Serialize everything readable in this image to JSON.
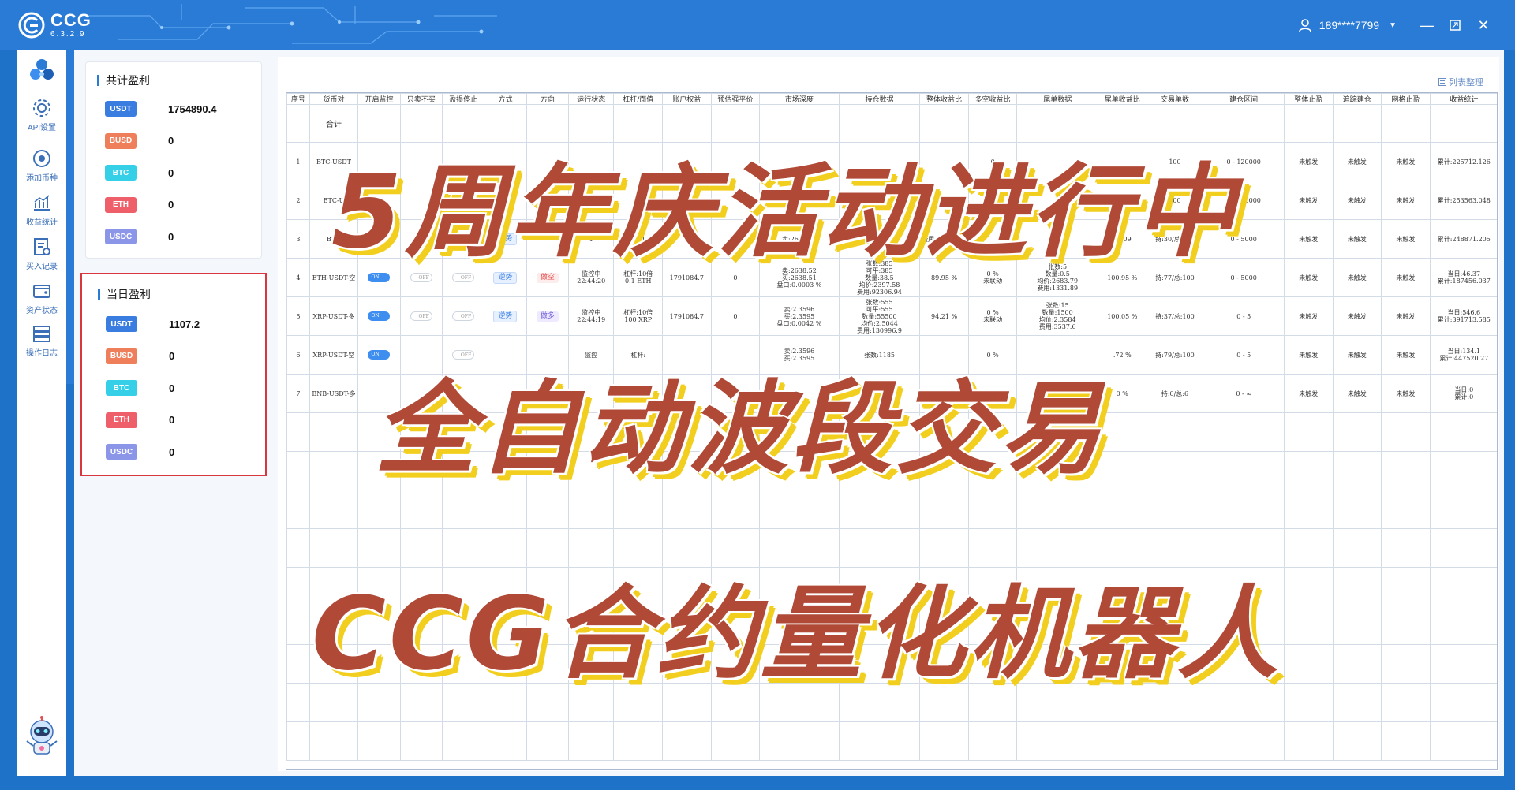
{
  "app": {
    "name": "CCG",
    "version": "6.3.2.9"
  },
  "user": {
    "phone": "189****7799"
  },
  "sidebar": {
    "items": [
      {
        "label": "API设置",
        "icon": "gear-icon"
      },
      {
        "label": "添加币种",
        "icon": "add-coin-icon"
      },
      {
        "label": "收益统计",
        "icon": "chart-icon"
      },
      {
        "label": "买入记录",
        "icon": "record-icon"
      },
      {
        "label": "资产状态",
        "icon": "wallet-icon"
      },
      {
        "label": "操作日志",
        "icon": "log-icon"
      }
    ]
  },
  "total_profit": {
    "title": "共计盈利",
    "rows": [
      {
        "coin": "USDT",
        "value": "1754890.4",
        "color": "#3a7de0"
      },
      {
        "coin": "BUSD",
        "value": "0",
        "color": "#ef7e5a"
      },
      {
        "coin": "BTC",
        "value": "0",
        "color": "#35d0e8"
      },
      {
        "coin": "ETH",
        "value": "0",
        "color": "#ee5f6a"
      },
      {
        "coin": "USDC",
        "value": "0",
        "color": "#8c96e8"
      }
    ]
  },
  "daily_profit": {
    "title": "当日盈利",
    "rows": [
      {
        "coin": "USDT",
        "value": "1107.2",
        "color": "#3a7de0"
      },
      {
        "coin": "BUSD",
        "value": "0",
        "color": "#ef7e5a"
      },
      {
        "coin": "BTC",
        "value": "0",
        "color": "#35d0e8"
      },
      {
        "coin": "ETH",
        "value": "0",
        "color": "#ee5f6a"
      },
      {
        "coin": "USDC",
        "value": "0",
        "color": "#8c96e8"
      }
    ]
  },
  "list_sort_label": "列表整理",
  "table": {
    "headers": [
      "序号",
      "货币对",
      "开启监控",
      "只卖不买",
      "盈损停止",
      "方式",
      "方向",
      "运行状态",
      "杠杆/面值",
      "账户权益",
      "预估强平价",
      "市场深度",
      "持仓数据",
      "整体收益比",
      "多空收益比",
      "尾单数据",
      "尾单收益比",
      "交易单数",
      "建仓区间",
      "整体止盈",
      "追踪建仓",
      "网格止盈",
      "收益统计"
    ],
    "sum_label": "合计",
    "rows": [
      {
        "idx": "1",
        "pair": "BTC-USDT",
        "cols": [
          "",
          "",
          "",
          "",
          "",
          "",
          "",
          "",
          "",
          "",
          "",
          "",
          "0",
          "",
          "",
          "100",
          "0 - 120000",
          "未触发",
          "未触发",
          "未触发",
          "当日:100.936",
          "累计:225712.126"
        ]
      },
      {
        "idx": "2",
        "pair": "BTC-U",
        "cols": [
          "",
          "",
          "",
          "",
          "",
          "",
          "",
          "0",
          "",
          "",
          "",
          "",
          "",
          "",
          ".7",
          "100",
          "0 - 120000",
          "未触发",
          "未触发",
          "未触发",
          "当日:0",
          "累计:253563.048"
        ]
      },
      {
        "idx": "3",
        "pair": "BTH",
        "cols": [
          "",
          "",
          "",
          "逆势",
          "",
          "1",
          "1 ET",
          "",
          "",
          "卖:2638.66",
          "卖0.0003 %",
          "费用:66127.13",
          "",
          "",
          "24.09",
          "持:30/总:100",
          "0 - 5000",
          "未触发",
          "未触发",
          "未触发",
          "当日:279.224",
          "累计:248871.205"
        ]
      },
      {
        "idx": "4",
        "pair": "ETH-USDT-空",
        "on": "ON",
        "off1": "OFF",
        "off2": "OFF",
        "mode": "逆势",
        "dir": "做空",
        "status": "监控中",
        "time": "22:44:20",
        "lev1": "杠杆:10倍",
        "lev2": "0.1 ETH",
        "equity": "1791084.7",
        "liq": "0",
        "depth": [
          "卖:2638.52",
          "买:2638.51",
          "盘口:0.0003 %"
        ],
        "pos": [
          "张数:385",
          "可平:385",
          "数量:38.5",
          "均价:2397.58",
          "费用:92306.94"
        ],
        "ratio": "89.95 %",
        "ls": [
          "0 %",
          "未联动"
        ],
        "tail": [
          "张数:5",
          "数量:0.5",
          "均价:2683.79",
          "费用:1331.89"
        ],
        "tailr": "100.95 %",
        "trades": "持:77/总:100",
        "range": "0 - 5000",
        "tp": "未触发",
        "track": "未触发",
        "grid": "未触发",
        "stat": [
          "当日:46.37",
          "累计:187456.037"
        ]
      },
      {
        "idx": "5",
        "pair": "XRP-USDT-多",
        "on": "ON",
        "off1": "OFF",
        "off2": "OFF",
        "mode": "逆势",
        "dir": "做多",
        "status": "监控中",
        "time": "22:44:19",
        "lev1": "杠杆:10倍",
        "lev2": "100 XRP",
        "equity": "1791084.7",
        "liq": "0",
        "depth": [
          "卖:2.3596",
          "买:2.3595",
          "盘口:0.0042 %"
        ],
        "pos": [
          "张数:555",
          "可平:555",
          "数量:55500",
          "均价:2.5044",
          "费用:130996.9"
        ],
        "ratio": "94.21 %",
        "ls": [
          "0 %",
          "未联动"
        ],
        "tail": [
          "张数:15",
          "数量:1500",
          "均价:2.3584",
          "费用:3537.6"
        ],
        "tailr": "100.05 %",
        "trades": "持:37/总:100",
        "range": "0 - 5",
        "tp": "未触发",
        "track": "未触发",
        "grid": "未触发",
        "stat": [
          "当日:546.6",
          "累计:391713.585"
        ]
      },
      {
        "idx": "6",
        "pair": "XRP-USDT-空",
        "on": "ON",
        "off2": "OFF",
        "status": "监控",
        "lev1": "杠杆:",
        "depth": [
          "卖:2.3596",
          "买:2.3595"
        ],
        "pos": [
          "张数:1185"
        ],
        "ls": [
          "0 %"
        ],
        "tailr": ".72 %",
        "trades": "持:79/总:100",
        "range": "0 - 5",
        "tp": "未触发",
        "track": "未触发",
        "grid": "未触发",
        "stat": [
          "当日:134.1",
          "累计:447520.27"
        ]
      },
      {
        "idx": "7",
        "pair": "BNB-USDT-多",
        "tailr": "0 %",
        "trades": "持:0/总:6",
        "range": "0 - ∞",
        "tp": "未触发",
        "track": "未触发",
        "grid": "未触发",
        "stat": [
          "当日:0",
          "累计:0"
        ]
      }
    ]
  },
  "banner": {
    "line1": "5周年庆活动进行中",
    "line2": "全自动波段交易",
    "line3": "CCG合约量化机器人"
  },
  "colors": {
    "brand": "#2a7bd6",
    "banner_text": "#b04a37",
    "banner_shadow": "#f2cf1e",
    "highlight_border": "#d9363e"
  }
}
